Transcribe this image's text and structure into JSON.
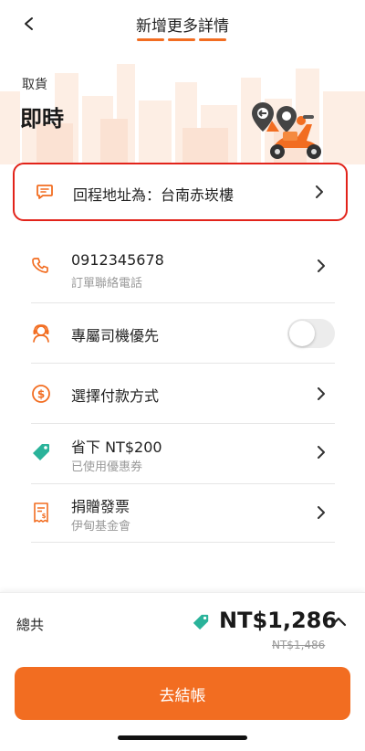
{
  "header": {
    "title": "新增更多詳情"
  },
  "hero": {
    "pickup_label": "取貨",
    "pickup_value": "即時"
  },
  "return_address": {
    "label": "回程地址為：台南赤崁樓"
  },
  "rows": {
    "phone": {
      "main": "0912345678",
      "sub": "訂單聯絡電話"
    },
    "driver": {
      "main": "專屬司機優先",
      "toggle_on": false
    },
    "payment": {
      "main": "選擇付款方式"
    },
    "coupon": {
      "main": "省下 NT$200",
      "sub": "已使用優惠券"
    },
    "invoice": {
      "main": "捐贈發票",
      "sub": "伊甸基金會"
    }
  },
  "summary": {
    "total_label": "總共",
    "total_amount": "NT$1,286",
    "original_price": "NT$1,486"
  },
  "checkout_button": "去結帳",
  "colors": {
    "accent": "#f26d21",
    "highlight": "#e2231a",
    "coupon_tag": "#2ab39a"
  },
  "icons": {
    "back": "chevron-left-icon",
    "address": "message-icon",
    "phone": "phone-icon",
    "driver": "driver-icon",
    "payment": "dollar-icon",
    "coupon": "tag-icon",
    "invoice": "receipt-icon"
  }
}
